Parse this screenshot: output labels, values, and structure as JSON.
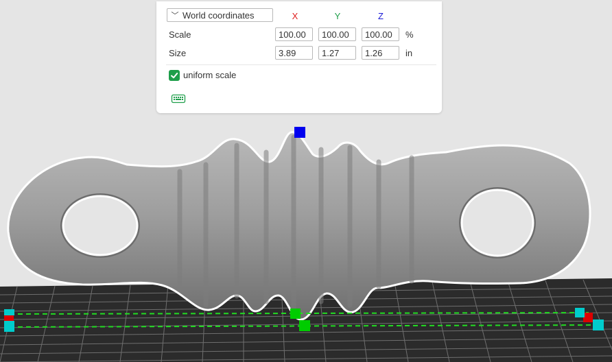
{
  "panel": {
    "coordinate_system": "World coordinates",
    "axes": {
      "x": {
        "label": "X",
        "color": "#e02020"
      },
      "y": {
        "label": "Y",
        "color": "#1e9e4a"
      },
      "z": {
        "label": "Z",
        "color": "#1a1ad6"
      }
    },
    "scale": {
      "label": "Scale",
      "x": "100.00",
      "y": "100.00",
      "z": "100.00",
      "unit": "%"
    },
    "size": {
      "label": "Size",
      "x": "3.89",
      "y": "1.27",
      "z": "1.26",
      "unit": "in"
    },
    "uniform_scale": {
      "label": "uniform scale",
      "checked": true
    },
    "keyboard_icon": "keyboard-icon"
  },
  "viewport": {
    "model": "bone-shaped object with ribbed center and two rings",
    "background_color": "#e5e5e5",
    "bed_color": "#2b2b2b",
    "handle_colors": {
      "z": "#0000ee",
      "y": "#00cc00",
      "x": "#dd0000",
      "corner": "#00cccc"
    }
  }
}
